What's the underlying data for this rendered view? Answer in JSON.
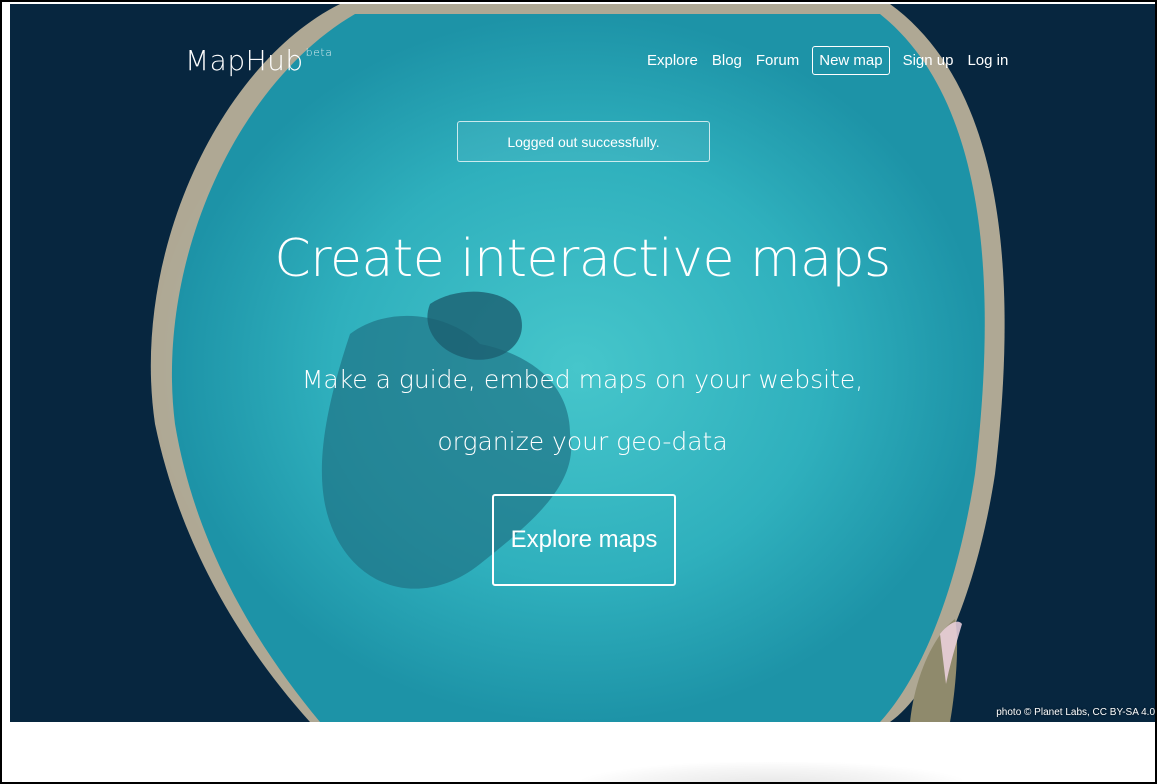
{
  "brand": {
    "name": "MapHub",
    "badge": "beta"
  },
  "nav": {
    "items": [
      "Explore",
      "Blog",
      "Forum",
      "New map",
      "Sign up",
      "Log in"
    ]
  },
  "flash": {
    "message": "Logged out successfully."
  },
  "hero": {
    "title": "Create interactive maps",
    "subtitle_line1": "Make a guide, embed maps on your website,",
    "subtitle_line2": "organize your geo-data",
    "cta_label": "Explore maps",
    "photo_credit": "photo © Planet Labs, CC BY-SA 4.0"
  },
  "colors": {
    "text_on_hero": "#ffffff",
    "ocean_deep": "#07263f",
    "lagoon": "#35b4bf"
  }
}
